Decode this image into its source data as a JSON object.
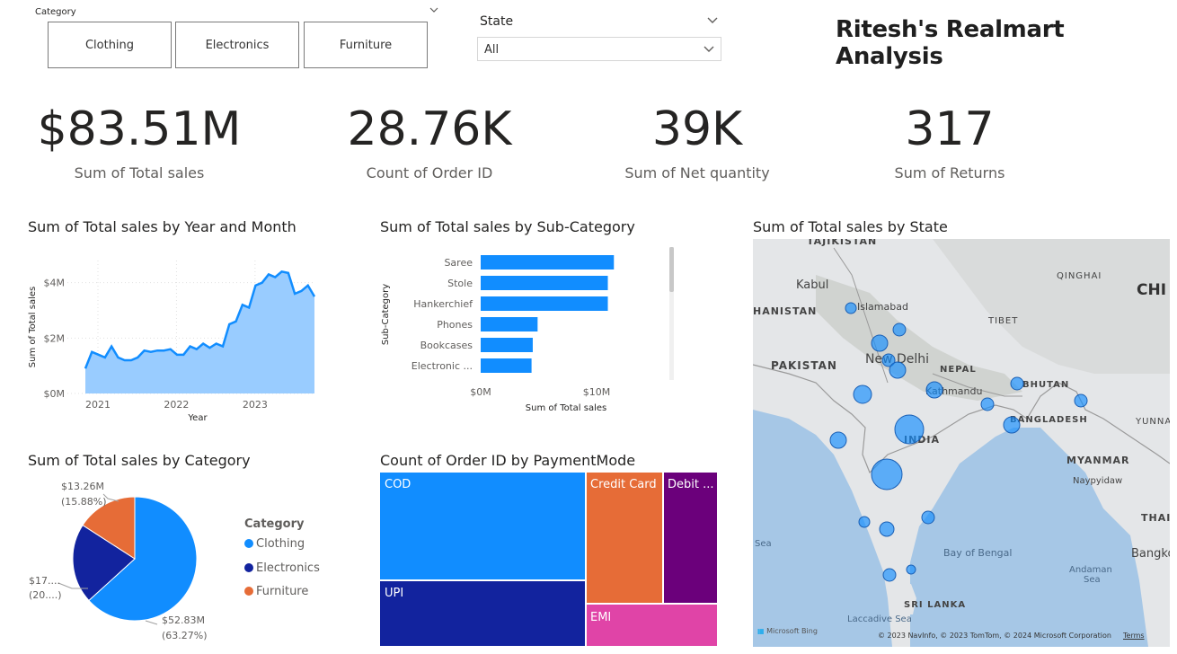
{
  "category_slicer": {
    "title": "Category",
    "options": [
      "Clothing",
      "Electronics",
      "Furniture"
    ]
  },
  "state_slicer": {
    "title": "State",
    "selected": "All"
  },
  "report_title": "Ritesh's Realmart Analysis",
  "kpis": [
    {
      "value": "$83.51M",
      "label": "Sum of Total sales"
    },
    {
      "value": "28.76K",
      "label": "Count of Order ID"
    },
    {
      "value": "39K",
      "label": "Sum of Net quantity"
    },
    {
      "value": "317",
      "label": "Sum of Returns"
    }
  ],
  "line_chart": {
    "title": "Sum of Total sales by Year and Month",
    "chart_data": {
      "type": "area",
      "title": "Sum of Total sales by Year and Month",
      "xlabel": "Year",
      "ylabel": "Sum of Total sales",
      "x_ticks": [
        "2021",
        "2022",
        "2023"
      ],
      "y_ticks": [
        "$0M",
        "$2M",
        "$4M"
      ],
      "ylim": [
        0,
        4.8
      ],
      "unit": "$M",
      "values": [
        0.9,
        1.5,
        1.4,
        1.3,
        1.7,
        1.3,
        1.2,
        1.2,
        1.3,
        1.55,
        1.5,
        1.55,
        1.55,
        1.6,
        1.4,
        1.4,
        1.7,
        1.6,
        1.8,
        1.65,
        1.8,
        1.7,
        2.5,
        2.6,
        3.2,
        3.1,
        3.9,
        4.0,
        4.3,
        4.2,
        4.4,
        4.35,
        3.6,
        3.7,
        3.9,
        3.5
      ],
      "color": "#118DFF",
      "fill": "#99CCFF"
    }
  },
  "bar_chart": {
    "title": "Sum of Total sales by Sub-Category",
    "chart_data": {
      "type": "bar",
      "title": "Sum of Total sales by Sub-Category",
      "xlabel": "Sum of Total sales",
      "ylabel": "Sub-Category",
      "categories": [
        "Saree",
        "Stole",
        "Hankerchief",
        "Phones",
        "Bookcases",
        "Electronic ..."
      ],
      "values": [
        11.0,
        10.5,
        10.5,
        4.7,
        4.3,
        4.2
      ],
      "x_ticks": [
        "$0M",
        "$10M"
      ],
      "xlim": [
        0,
        11.5
      ],
      "unit": "$M",
      "color": "#118DFF"
    }
  },
  "pie_chart": {
    "title": "Sum of Total sales by Category",
    "legend_title": "Category",
    "chart_data": {
      "type": "pie",
      "title": "Sum of Total sales by Category",
      "slices": [
        {
          "name": "Clothing",
          "value": 52.83,
          "percent": 63.27,
          "label": "$52.83M",
          "pct_label": "(63.27%)",
          "color": "#118DFF"
        },
        {
          "name": "Electronics",
          "value": 17.42,
          "percent": 20.85,
          "label": "$17....",
          "pct_label": "(20....)",
          "color": "#12239E"
        },
        {
          "name": "Furniture",
          "value": 13.26,
          "percent": 15.88,
          "label": "$13.26M",
          "pct_label": "(15.88%)",
          "color": "#E66C37"
        }
      ]
    }
  },
  "treemap": {
    "title": "Count of Order ID by PaymentMode",
    "chart_data": {
      "type": "treemap",
      "title": "Count of Order ID by PaymentMode",
      "items": [
        {
          "name": "COD",
          "label": "COD",
          "color": "#118DFF",
          "value": 9450
        },
        {
          "name": "UPI",
          "label": "UPI",
          "color": "#12239E",
          "value": 5900
        },
        {
          "name": "Credit Card",
          "label": "Credit Card",
          "color": "#E66C37",
          "value": 6180
        },
        {
          "name": "Debit Card",
          "label": "Debit ...",
          "color": "#6B007B",
          "value": 4520
        },
        {
          "name": "EMI",
          "label": "EMI",
          "color": "#E044A7",
          "value": 2710
        }
      ]
    }
  },
  "map": {
    "title": "Sum of Total sales by State",
    "labels": {
      "tajikistan": "TAJIKISTAN",
      "qinghai": "QINGHAI",
      "kabul": "Kabul",
      "chi": "CHI",
      "afghanistan": "HANISTAN",
      "islamabad": "Islamabad",
      "tibet": "TIBET",
      "pakistan": "PAKISTAN",
      "newdelhi": "New Delhi",
      "nepal": "NEPAL",
      "kathmandu": "Kathmandu",
      "bhutan": "BHUTAN",
      "bangladesh": "BANGLADESH",
      "yunna": "YUNNA",
      "india": "INDIA",
      "myanmar": "MYANMAR",
      "naypyidaw": "Naypyidaw",
      "thaila": "THAILA",
      "sea": "Sea",
      "bayofbengal": "Bay of Bengal",
      "bangkok": "Bangkok",
      "andaman": "Andaman",
      "andaman_sea": "Sea",
      "srilanka": "SRI LANKA",
      "laccadive": "Laccadive Sea",
      "bing": "Microsoft Bing",
      "copyright": "© 2023 NavInfo, © 2023 TomTom, © 2024 Microsoft Corporation",
      "terms": "Terms"
    },
    "bubble_color": "#118DFF"
  }
}
